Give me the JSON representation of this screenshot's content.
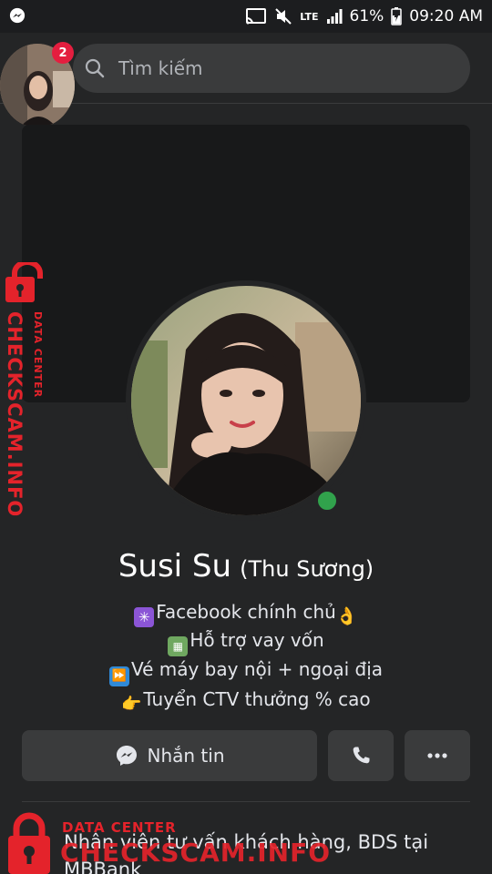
{
  "status_bar": {
    "network": "LTE",
    "battery": "61%",
    "time": "09:20 AM"
  },
  "header": {
    "notification_count": "2",
    "search_placeholder": "Tìm kiếm"
  },
  "profile": {
    "name": "Susi Su",
    "alt_name": "(Thu Sương)",
    "online": true,
    "bio": [
      {
        "icon": "asterisk-emoji-icon",
        "text": "Facebook chính chủ",
        "trail_icon": "ok-hand-emoji-icon"
      },
      {
        "icon": "abacus-emoji-icon",
        "text": "Hỗ trợ vay vốn"
      },
      {
        "icon": "fast-forward-emoji-icon",
        "text": "Vé máy bay nội + ngoại địa"
      },
      {
        "icon": "pointing-hand-emoji-icon",
        "text": "Tuyển CTV thưởng % cao"
      }
    ]
  },
  "actions": {
    "message_label": "Nhắn tin"
  },
  "job": {
    "text": "Nhân viên tư vấn khách hàng, BDS tại MBBank"
  },
  "watermark": {
    "main": "CHECKSCAM.INFO",
    "sub": "DATA CENTER"
  },
  "colors": {
    "background": "#242526",
    "button": "#3a3b3c",
    "online": "#31a24c",
    "badge": "#e41e3f",
    "watermark": "#e4232b"
  }
}
